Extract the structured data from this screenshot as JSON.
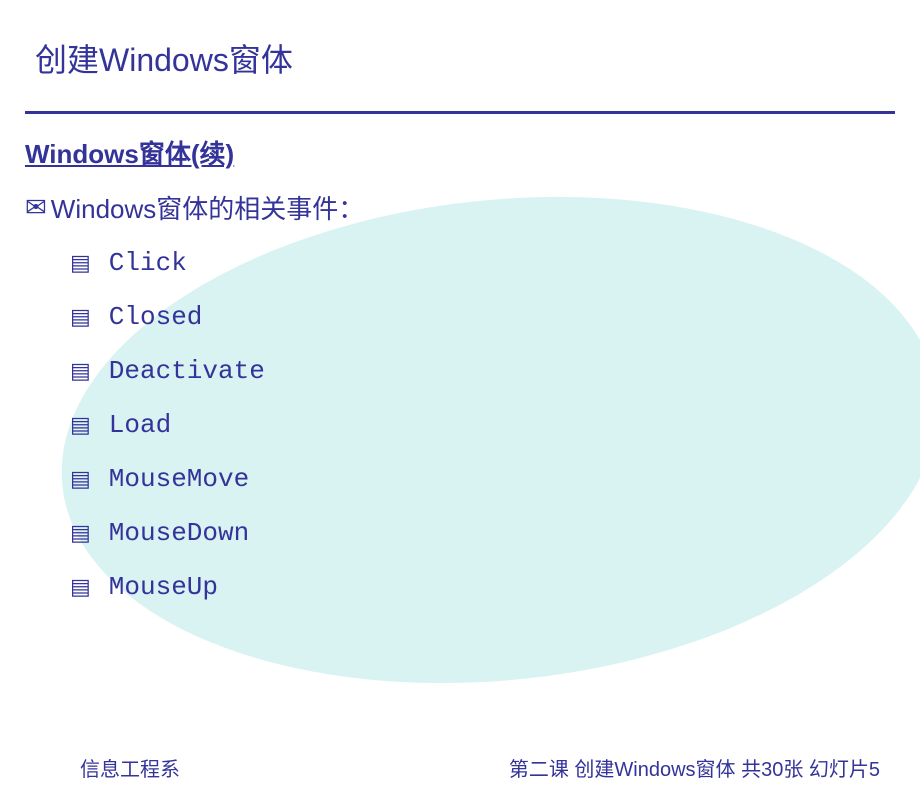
{
  "title": "创建Windows窗体",
  "section_heading": "Windows窗体(续)",
  "intro_text": "Windows窗体的相关事件：",
  "events": [
    "Click",
    "Closed",
    "Deactivate",
    "Load",
    "MouseMove",
    "MouseDown",
    "MouseUp"
  ],
  "footer": {
    "left": "信息工程系",
    "right": "第二课 创建Windows窗体 共30张 幻灯片5"
  }
}
